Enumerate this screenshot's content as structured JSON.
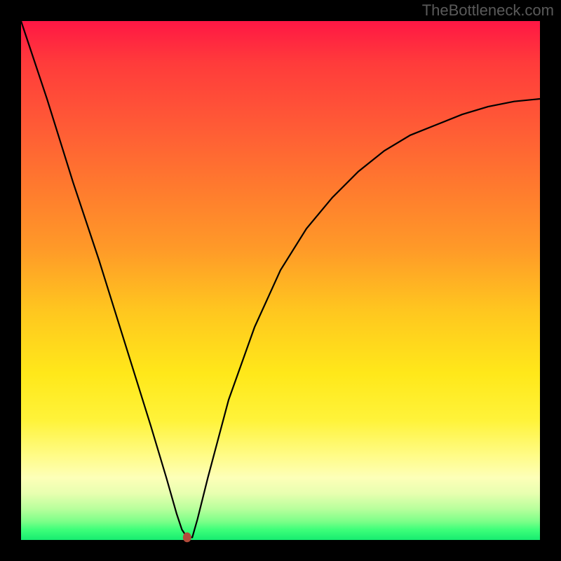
{
  "watermark": "TheBottleneck.com",
  "chart_data": {
    "type": "line",
    "title": "",
    "xlabel": "",
    "ylabel": "",
    "xlim": [
      0,
      100
    ],
    "ylim": [
      0,
      100
    ],
    "series": [
      {
        "name": "bottleneck-curve",
        "x": [
          0,
          5,
          10,
          15,
          20,
          25,
          28,
          30,
          31,
          32,
          33,
          34,
          36,
          40,
          45,
          50,
          55,
          60,
          65,
          70,
          75,
          80,
          85,
          90,
          95,
          100
        ],
        "values": [
          100,
          85,
          69,
          54,
          38,
          22,
          12,
          5,
          2,
          0.5,
          0.5,
          4,
          12,
          27,
          41,
          52,
          60,
          66,
          71,
          75,
          78,
          80,
          82,
          83.5,
          84.5,
          85
        ]
      }
    ],
    "marker": {
      "x": 32,
      "y": 0.5
    },
    "gradient_bands": [
      {
        "color": "#ff1744",
        "pos": 100
      },
      {
        "color": "#ff9a28",
        "pos": 56
      },
      {
        "color": "#ffe81a",
        "pos": 32
      },
      {
        "color": "#17ec70",
        "pos": 0
      }
    ]
  }
}
